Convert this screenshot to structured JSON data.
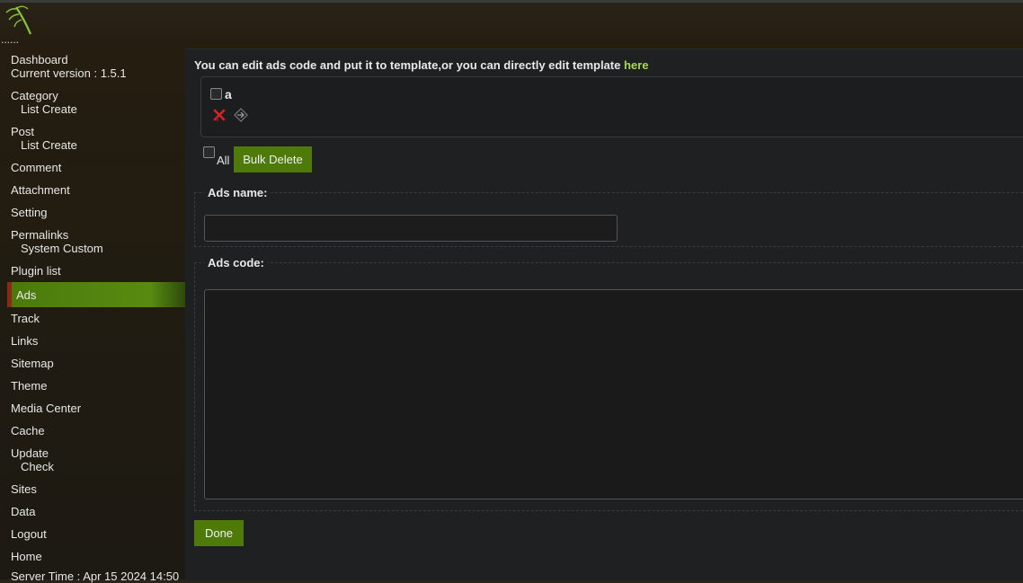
{
  "brand": {
    "dots": "......"
  },
  "sidebar": {
    "dashboard": "Dashboard",
    "version": "Current version : 1.5.1",
    "category": "Category",
    "category_sub": "List Create",
    "post": "Post",
    "post_sub": "List Create",
    "comment": "Comment",
    "attachment": "Attachment",
    "setting": "Setting",
    "permalinks": "Permalinks",
    "permalinks_sub": "System Custom",
    "plugin_list": "Plugin list",
    "ads": "Ads",
    "track": "Track",
    "links": "Links",
    "sitemap": "Sitemap",
    "theme": "Theme",
    "media_center": "Media Center",
    "cache": "Cache",
    "update": "Update",
    "update_sub": "Check",
    "sites": "Sites",
    "data": "Data",
    "logout": "Logout",
    "home": "Home",
    "server_time": "Server Time : Apr 15 2024 14:50"
  },
  "main": {
    "intro_text": "You can edit ads code and put it to template,or you can directly edit template",
    "intro_link": "here",
    "ad_item_name": "a",
    "all_label": "All",
    "bulk_delete": "Bulk Delete",
    "ads_name_label": "Ads name:",
    "ads_name_value": "",
    "ads_code_label": "Ads code:",
    "ads_code_value": "",
    "done": "Done"
  },
  "colors": {
    "accent_green": "#4e7a0a",
    "link_green": "#a8d85a",
    "active_marker": "#8a2a14"
  },
  "icons": {
    "logo": "leaf-logo-icon",
    "delete": "delete-icon",
    "edit": "edit-icon"
  }
}
